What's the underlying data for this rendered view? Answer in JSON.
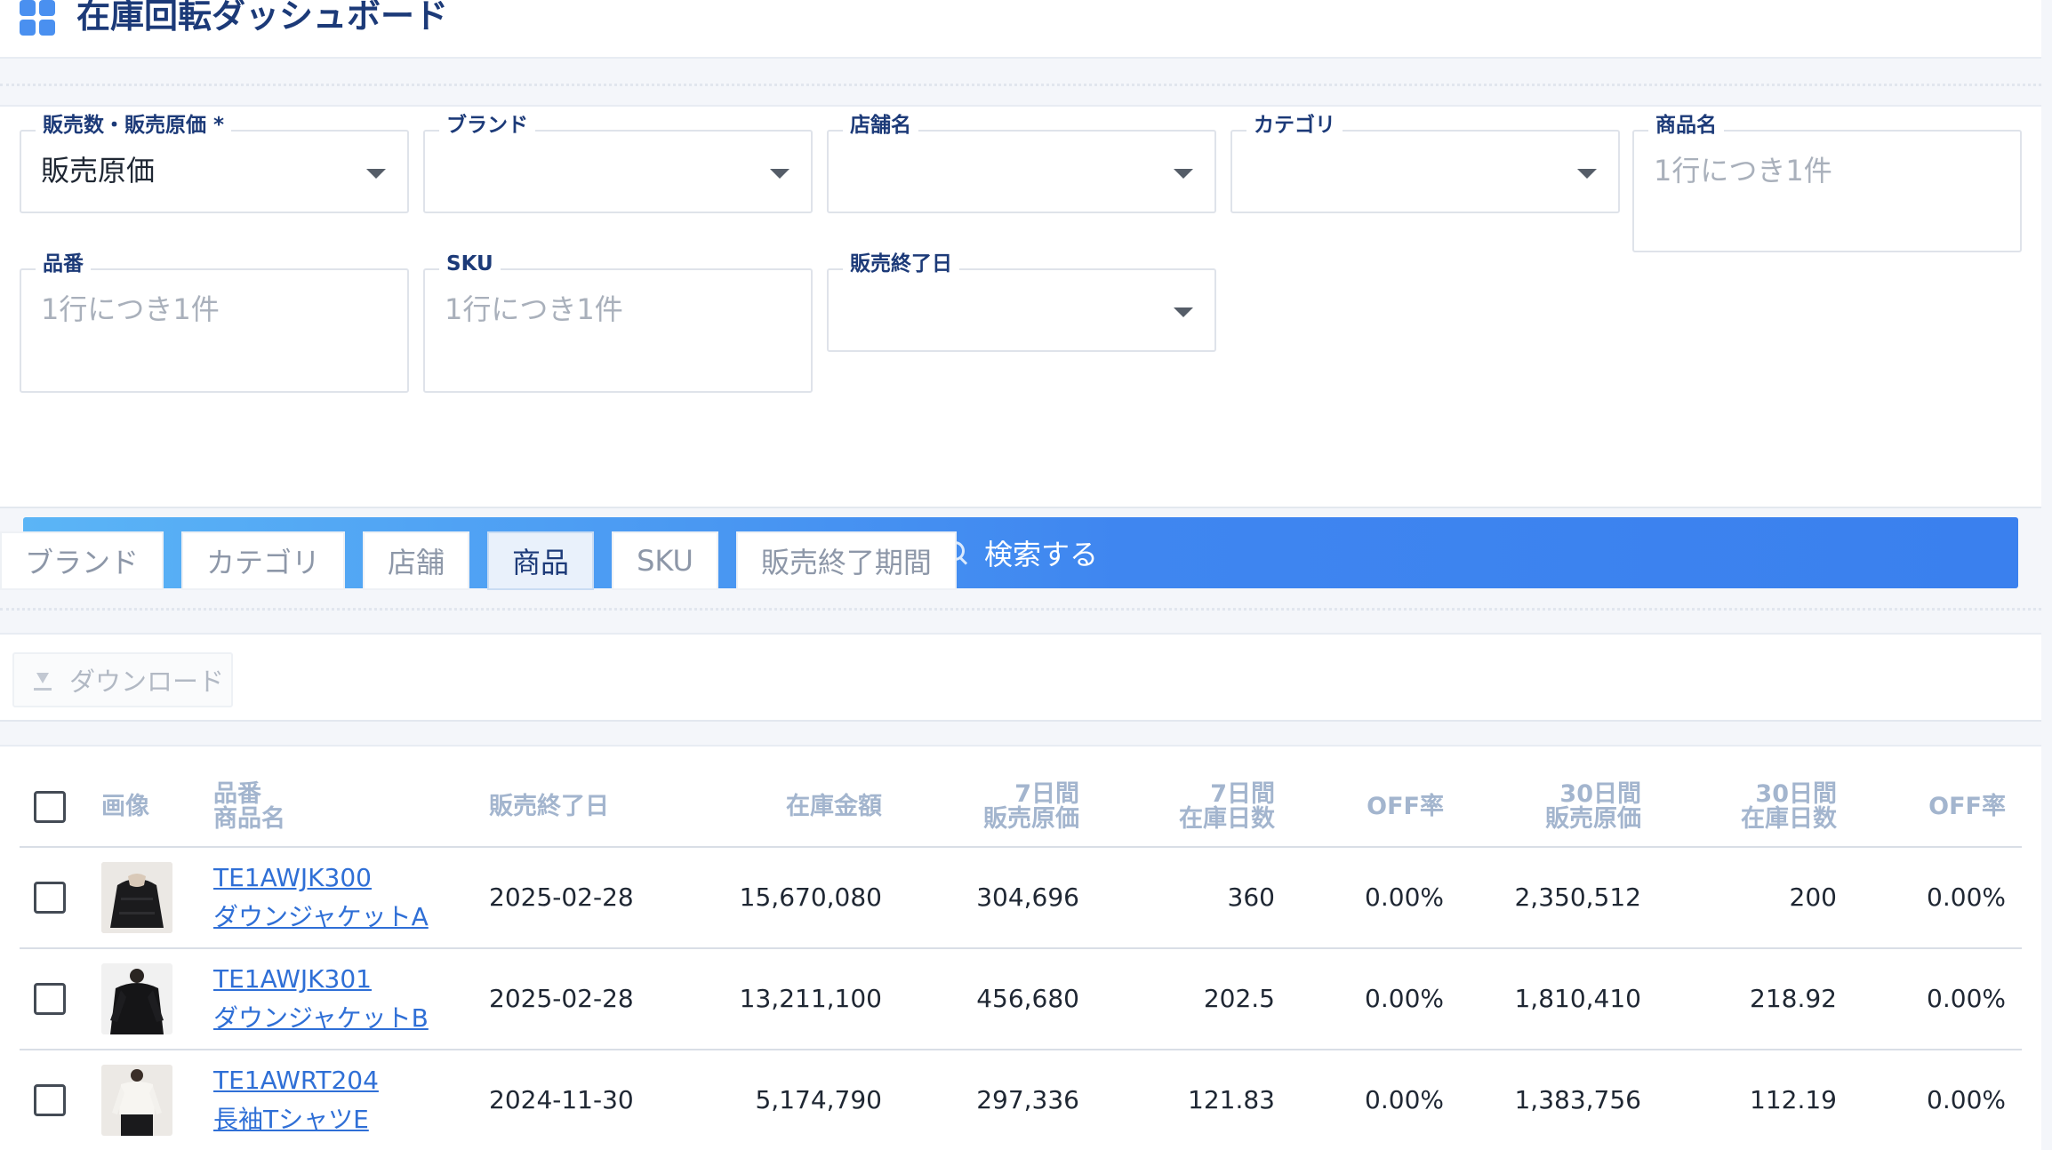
{
  "header": {
    "title": "在庫回転ダッシュボード"
  },
  "filters": {
    "metric": {
      "label": "販売数・販売原価 *",
      "value": "販売原価"
    },
    "brand": {
      "label": "ブランド"
    },
    "store": {
      "label": "店舗名"
    },
    "category": {
      "label": "カテゴリ"
    },
    "product_name": {
      "label": "商品名",
      "placeholder": "1行につき1件"
    },
    "part_number": {
      "label": "品番",
      "placeholder": "1行につき1件"
    },
    "sku": {
      "label": "SKU",
      "placeholder": "1行につき1件"
    },
    "end_date": {
      "label": "販売終了日"
    },
    "search_label": "検索する"
  },
  "tabs": [
    {
      "label": "ブランド",
      "active": false
    },
    {
      "label": "カテゴリ",
      "active": false
    },
    {
      "label": "店舗",
      "active": false
    },
    {
      "label": "商品",
      "active": true
    },
    {
      "label": "SKU",
      "active": false
    },
    {
      "label": "販売終了期間",
      "active": false
    }
  ],
  "toolbar": {
    "download_label": "ダウンロード"
  },
  "table": {
    "headers": {
      "image": "画像",
      "part_line1": "品番",
      "part_line2": "商品名",
      "end_date": "販売終了日",
      "stock_amount": "在庫金額",
      "d7_cost_line1": "7日間",
      "d7_cost_line2": "販売原価",
      "d7_days_line1": "7日間",
      "d7_days_line2": "在庫日数",
      "off1": "OFF率",
      "d30_cost_line1": "30日間",
      "d30_cost_line2": "販売原価",
      "d30_days_line1": "30日間",
      "d30_days_line2": "在庫日数",
      "off2": "OFF率"
    },
    "rows": [
      {
        "part_number": "TE1AWJK300",
        "name": "ダウンジャケットA",
        "end_date": "2025-02-28",
        "stock_amount": "15,670,080",
        "d7_cost": "304,696",
        "d7_days": "360",
        "off7": "0.00%",
        "d30_cost": "2,350,512",
        "d30_days": "200",
        "off30": "0.00%"
      },
      {
        "part_number": "TE1AWJK301",
        "name": "ダウンジャケットB",
        "end_date": "2025-02-28",
        "stock_amount": "13,211,100",
        "d7_cost": "456,680",
        "d7_days": "202.5",
        "off7": "0.00%",
        "d30_cost": "1,810,410",
        "d30_days": "218.92",
        "off30": "0.00%"
      },
      {
        "part_number": "TE1AWRT204",
        "name": "長袖TシャツE",
        "end_date": "2024-11-30",
        "stock_amount": "5,174,790",
        "d7_cost": "297,336",
        "d7_days": "121.83",
        "off7": "0.00%",
        "d30_cost": "1,383,756",
        "d30_days": "112.19",
        "off30": "0.00%"
      }
    ]
  }
}
